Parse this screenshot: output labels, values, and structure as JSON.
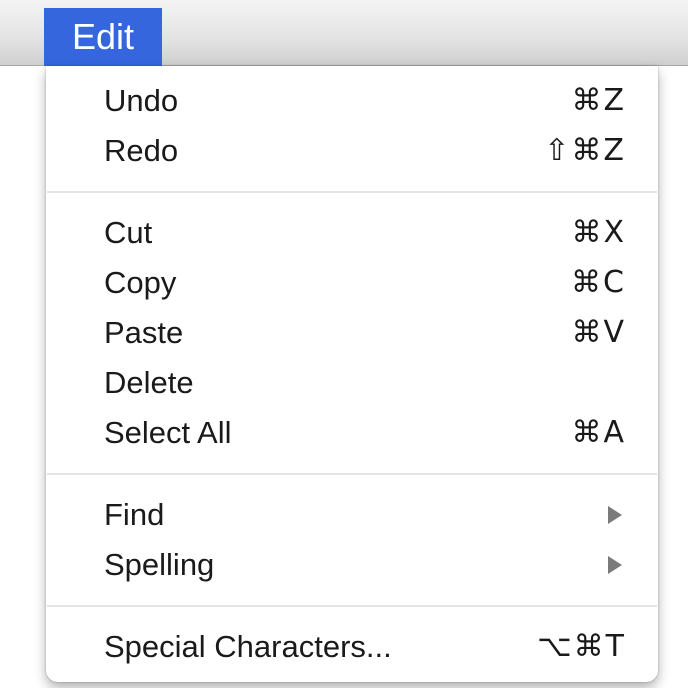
{
  "menubar": {
    "title": "Edit",
    "highlight_color": "#3566de"
  },
  "menu": {
    "groups": [
      [
        {
          "label": "Undo",
          "shortcut": "⌘Z"
        },
        {
          "label": "Redo",
          "shortcut": "⇧⌘Z"
        }
      ],
      [
        {
          "label": "Cut",
          "shortcut": "⌘X"
        },
        {
          "label": "Copy",
          "shortcut": "⌘C"
        },
        {
          "label": "Paste",
          "shortcut": "⌘V"
        },
        {
          "label": "Delete",
          "shortcut": ""
        },
        {
          "label": "Select All",
          "shortcut": "⌘A"
        }
      ],
      [
        {
          "label": "Find",
          "submenu": true,
          "icon": "submenu-arrow-icon"
        },
        {
          "label": "Spelling",
          "submenu": true,
          "icon": "submenu-arrow-icon"
        }
      ],
      [
        {
          "label": "Special Characters...",
          "shortcut": "⌥⌘T"
        }
      ]
    ]
  }
}
